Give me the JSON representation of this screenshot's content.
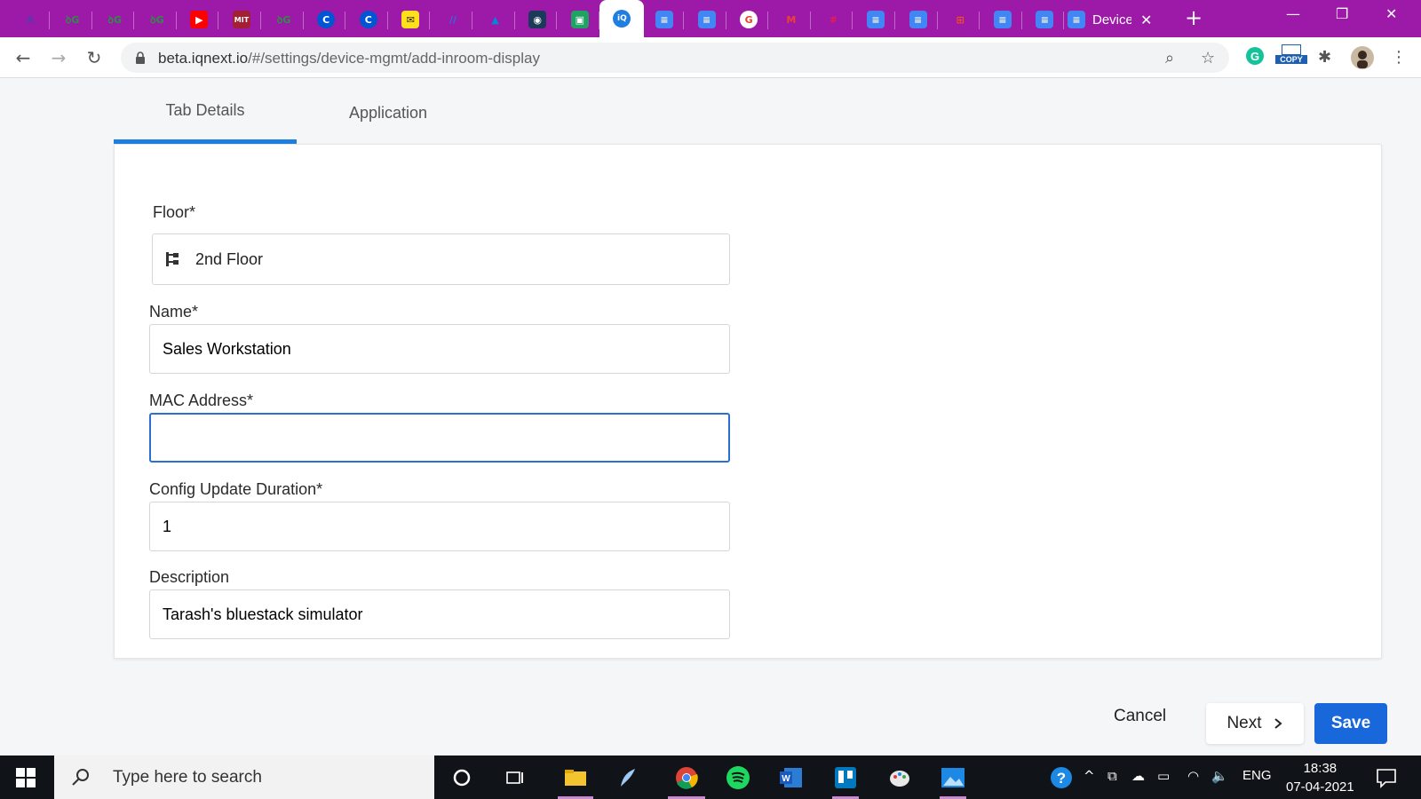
{
  "browser": {
    "tabs": [
      {
        "icon": "anaconda-icon",
        "glyph": "A",
        "color": "#5b36b1"
      },
      {
        "icon": "geeksforgeeks-icon",
        "glyph": "ꝺG",
        "color": "#2f8d46"
      },
      {
        "icon": "geeksforgeeks-icon",
        "glyph": "ꝺG",
        "color": "#2f8d46"
      },
      {
        "icon": "geeksforgeeks-icon",
        "glyph": "ꝺG",
        "color": "#2f8d46"
      },
      {
        "icon": "youtube-icon",
        "glyph": "▶",
        "color": "#ff0000"
      },
      {
        "icon": "mit-ocw-icon",
        "glyph": "MIT",
        "color": "#a31f34"
      },
      {
        "icon": "geeksforgeeks-icon",
        "glyph": "ꝺG",
        "color": "#2f8d46"
      },
      {
        "icon": "coursera-icon",
        "glyph": "C",
        "color": "#0056d2"
      },
      {
        "icon": "coursera-icon",
        "glyph": "C",
        "color": "#0056d2"
      },
      {
        "icon": "mailchimp-icon",
        "glyph": "✉",
        "color": "#ffe01b"
      },
      {
        "icon": "stripes-icon",
        "glyph": "//",
        "color": "#2f6fe0"
      },
      {
        "icon": "azure-icon",
        "glyph": "▲",
        "color": "#0089d6"
      },
      {
        "icon": "eye-app-icon",
        "glyph": "◉",
        "color": "#1b3a5a"
      },
      {
        "icon": "google-chat-icon",
        "glyph": "▣",
        "color": "#1ea362"
      },
      {
        "icon": "iqnext-icon",
        "glyph": "iQ",
        "color": "#1f7ee0",
        "active": true
      },
      {
        "icon": "google-docs-icon",
        "glyph": "≡",
        "color": "#4285f4"
      },
      {
        "icon": "google-docs-icon",
        "glyph": "≡",
        "color": "#4285f4"
      },
      {
        "icon": "google-icon",
        "glyph": "G",
        "color": "#ea4335"
      },
      {
        "icon": "gmail-icon",
        "glyph": "M",
        "color": "#ea4335"
      },
      {
        "icon": "slack-icon",
        "glyph": "#",
        "color": "#e01e5a"
      },
      {
        "icon": "google-docs-icon",
        "glyph": "≡",
        "color": "#4285f4"
      },
      {
        "icon": "google-docs-icon",
        "glyph": "≡",
        "color": "#4285f4"
      },
      {
        "icon": "microsoft-icon",
        "glyph": "⊞",
        "color": "#f25022"
      },
      {
        "icon": "google-docs-icon",
        "glyph": "≡",
        "color": "#4285f4"
      },
      {
        "icon": "google-docs-icon",
        "glyph": "≡",
        "color": "#4285f4"
      }
    ],
    "last_tab_title": "Device",
    "url_host": "beta.iqnext.io",
    "url_path": "/#/settings/device-mgmt/add-inroom-display",
    "copy_badge": "COPY"
  },
  "page": {
    "tabs": [
      "Tab Details",
      "Application"
    ],
    "selected_tab": "Tab Details",
    "accent": "#1f7ee0",
    "fields": {
      "floor": {
        "label": "Floor*",
        "value": "2nd Floor"
      },
      "name": {
        "label": "Name*",
        "value": "Sales Workstation"
      },
      "mac": {
        "label": "MAC Address*",
        "value": ""
      },
      "config": {
        "label": "Config Update Duration*",
        "value": "1"
      },
      "description": {
        "label": "Description",
        "value": "Tarash's bluestack simulator"
      }
    },
    "actions": {
      "cancel": "Cancel",
      "next": "Next",
      "save": "Save"
    }
  },
  "taskbar": {
    "search_placeholder": "Type here to search",
    "language": "ENG",
    "time": "18:38",
    "date": "07-04-2021"
  }
}
